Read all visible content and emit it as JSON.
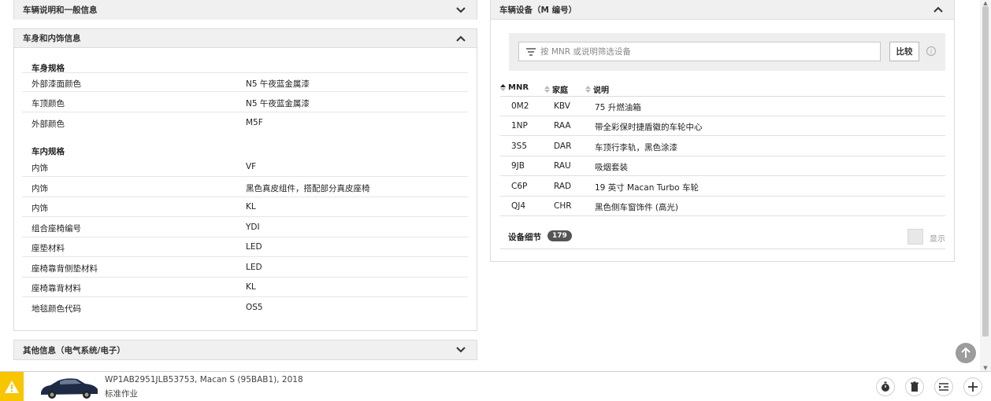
{
  "panels": {
    "vehicle_general": {
      "title": "车辆说明和一般信息"
    },
    "body_interior": {
      "title": "车身和内饰信息",
      "body_specs_title": "车身规格",
      "body_specs": [
        {
          "label": "外部漆面颜色",
          "value": "N5 午夜蓝金属漆"
        },
        {
          "label": "车顶颜色",
          "value": "N5 午夜蓝金属漆"
        },
        {
          "label": "外部颜色",
          "value": "M5F"
        }
      ],
      "interior_specs_title": "车内规格",
      "interior_specs": [
        {
          "label": "内饰",
          "value": "VF"
        },
        {
          "label": "内饰",
          "value": "黑色真皮组件，搭配部分真皮座椅"
        },
        {
          "label": "内饰",
          "value": "KL"
        },
        {
          "label": "组合座椅编号",
          "value": "YDI"
        },
        {
          "label": "座垫材料",
          "value": "LED"
        },
        {
          "label": "座椅靠背侧垫材料",
          "value": "LED"
        },
        {
          "label": "座椅靠背材料",
          "value": "KL"
        },
        {
          "label": "地毯颜色代码",
          "value": "OS5"
        }
      ]
    },
    "other_info": {
      "title": "其他信息（电气系统/电子）"
    },
    "equipment": {
      "title": "车辆设备（M 编号）",
      "filter_placeholder": "按 MNR 或说明筛选设备",
      "compare_label": "比较",
      "info_glyph": "i",
      "columns": [
        "MNR",
        "家庭",
        "说明"
      ],
      "rows": [
        {
          "mnr": "0M2",
          "family": "KBV",
          "desc": "75 升燃油箱"
        },
        {
          "mnr": "1NP",
          "family": "RAA",
          "desc": "带全彩保时捷盾徽的车轮中心"
        },
        {
          "mnr": "3S5",
          "family": "DAR",
          "desc": "车顶行李轨，黑色涂漆"
        },
        {
          "mnr": "9JB",
          "family": "RAU",
          "desc": "吸烟套装"
        },
        {
          "mnr": "C6P",
          "family": "RAD",
          "desc": "19 英寸 Macan Turbo 车轮"
        },
        {
          "mnr": "QJ4",
          "family": "CHR",
          "desc": "黑色侧车窗饰件 (高光)"
        }
      ],
      "details_label": "设备细节",
      "details_count": "179",
      "show_label": "显示"
    }
  },
  "bottom_bar": {
    "vin_line": "WP1AB2951JLB53753, Macan S (95BAB1), 2018",
    "sub_line": "标准作业"
  },
  "icons": {
    "chevron": "chevron-icon",
    "filter": "filter-icon",
    "warning": "warning-icon",
    "timer": "stopwatch-icon",
    "trash": "trash-icon",
    "indent": "indent-icon",
    "plus": "plus-icon",
    "up": "arrow-up-icon"
  },
  "colors": {
    "warning": "#f7c600",
    "car_body": "#1f2a44",
    "header_bg": "#f0f0f0"
  }
}
